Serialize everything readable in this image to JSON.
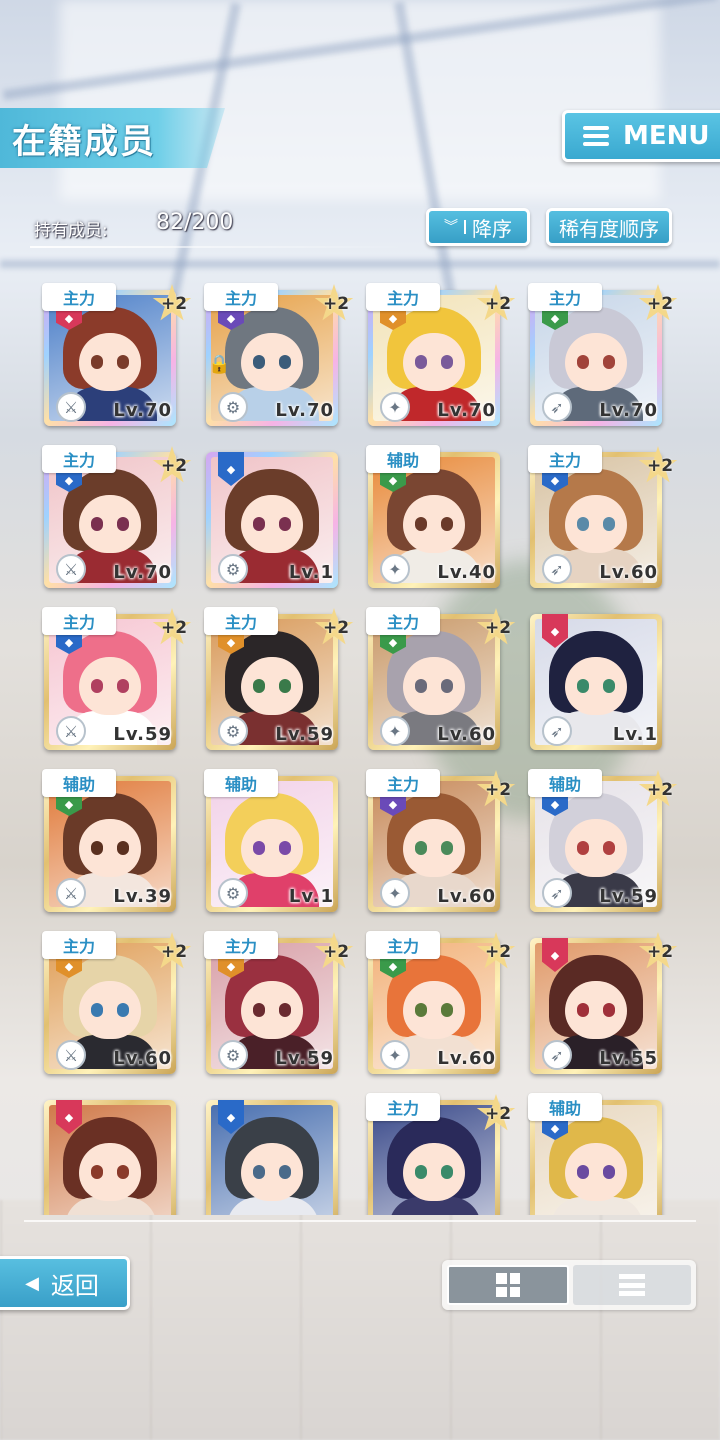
{
  "header": {
    "title": "在籍成员",
    "menu_label": "MENU"
  },
  "member_count": {
    "label": "持有成员:",
    "value": "82/200"
  },
  "sort": {
    "order_label": "降序",
    "order_icon": "chevron-double-down-icon",
    "rarity_label": "稀有度顺序"
  },
  "cards": [
    {
      "role": "主力",
      "attr": "red",
      "plus": "+2",
      "level": "Lv.70",
      "frame": "rainbow",
      "hair": "#8b3b2a",
      "eyes": "#7a3b2a",
      "outfit": "#2c3f7a",
      "bg": "#4c7fc8"
    },
    {
      "role": "主力",
      "attr": "purple",
      "plus": "+2",
      "level": "Lv.70",
      "frame": "rainbow",
      "hair": "#6f7780",
      "eyes": "#3b5c7a",
      "outfit": "#b8d0e8",
      "bg": "#e6a24a",
      "locked": true
    },
    {
      "role": "主力",
      "attr": "orange",
      "plus": "+2",
      "level": "Lv.70",
      "frame": "rainbow",
      "hair": "#f1c53c",
      "eyes": "#7a5a9a",
      "outfit": "#c0282b",
      "bg": "#f2e3b8"
    },
    {
      "role": "主力",
      "attr": "green",
      "plus": "+2",
      "level": "Lv.70",
      "frame": "rainbow",
      "hair": "#c9c9d6",
      "eyes": "#a1433a",
      "outfit": "#5e6a7a",
      "bg": "#c7d6e8"
    },
    {
      "role": "主力",
      "attr": "blue",
      "plus": "+2",
      "level": "Lv.70",
      "frame": "rainbow",
      "hair": "#6b3d2a",
      "eyes": "#7a3050",
      "outfit": "#9a2b32",
      "bg": "#f0c4c8"
    },
    {
      "role": "",
      "attr": "blue",
      "plus": "",
      "level": "Lv.1",
      "frame": "rainbow",
      "hair": "#6b3d2a",
      "eyes": "#7a3050",
      "outfit": "#9a2b32",
      "bg": "#f0c4c8"
    },
    {
      "role": "辅助",
      "attr": "green",
      "plus": "",
      "level": "Lv.40",
      "frame": "gold",
      "hair": "#7a4632",
      "eyes": "#6a3a2a",
      "outfit": "#f0ece6",
      "bg": "#e88a3a"
    },
    {
      "role": "主力",
      "attr": "blue",
      "plus": "+2",
      "level": "Lv.60",
      "frame": "gold",
      "hair": "#b5794a",
      "eyes": "#5a8aa8",
      "outfit": "#e6d3c2",
      "bg": "#d8c3a3"
    },
    {
      "role": "主力",
      "attr": "blue",
      "plus": "+2",
      "level": "Lv.59",
      "frame": "gold",
      "hair": "#ee6f8a",
      "eyes": "#b04060",
      "outfit": "#ffffff",
      "bg": "#f6c6d2"
    },
    {
      "role": "主力",
      "attr": "orange",
      "plus": "+2",
      "level": "Lv.59",
      "frame": "gold",
      "hair": "#2b2628",
      "eyes": "#3a7a4a",
      "outfit": "#7a3030",
      "bg": "#d89a5a"
    },
    {
      "role": "主力",
      "attr": "green",
      "plus": "+2",
      "level": "Lv.60",
      "frame": "gold",
      "hair": "#a8a2ad",
      "eyes": "#6a6a7a",
      "outfit": "#7a7a80",
      "bg": "#c99a6a"
    },
    {
      "role": "",
      "attr": "red",
      "plus": "",
      "level": "Lv.1",
      "frame": "gold",
      "hair": "#1f2240",
      "eyes": "#3a8a6a",
      "outfit": "#e8e8ec",
      "bg": "#d6dae8"
    },
    {
      "role": "辅助",
      "attr": "green",
      "plus": "",
      "level": "Lv.39",
      "frame": "gold",
      "hair": "#6a3a28",
      "eyes": "#5a3020",
      "outfit": "#f3e6de",
      "bg": "#e07a3a"
    },
    {
      "role": "辅助",
      "attr": "",
      "plus": "",
      "level": "Lv.1",
      "frame": "gold",
      "hair": "#f3cf5a",
      "eyes": "#7a4aa8",
      "outfit": "#e0406a",
      "bg": "#f2d2e8"
    },
    {
      "role": "主力",
      "attr": "purple",
      "plus": "+2",
      "level": "Lv.60",
      "frame": "gold",
      "hair": "#9a5a34",
      "eyes": "#4a8a5a",
      "outfit": "#e8d8cc",
      "bg": "#c78a5a"
    },
    {
      "role": "辅助",
      "attr": "blue",
      "plus": "+2",
      "level": "Lv.59",
      "frame": "gold",
      "hair": "#d2d0da",
      "eyes": "#b04040",
      "outfit": "#3a3a48",
      "bg": "#e6e2e8"
    },
    {
      "role": "主力",
      "attr": "orange",
      "plus": "+2",
      "level": "Lv.60",
      "frame": "gold",
      "hair": "#e6d4a8",
      "eyes": "#3a7ab0",
      "outfit": "#2a2a30",
      "bg": "#e0a05a"
    },
    {
      "role": "主力",
      "attr": "orange",
      "plus": "+2",
      "level": "Lv.59",
      "frame": "gold",
      "hair": "#9a3040",
      "eyes": "#6a2a30",
      "outfit": "#4a2028",
      "bg": "#d8a0a8"
    },
    {
      "role": "主力",
      "attr": "green",
      "plus": "+2",
      "level": "Lv.60",
      "frame": "gold",
      "hair": "#e8743a",
      "eyes": "#5a7a3a",
      "outfit": "#f2e0d2",
      "bg": "#f2b27a"
    },
    {
      "role": "",
      "attr": "red",
      "plus": "+2",
      "level": "Lv.55",
      "frame": "gold",
      "hair": "#5a2a24",
      "eyes": "#a0303a",
      "outfit": "#2a2028",
      "bg": "#e09a6a"
    },
    {
      "role": "",
      "attr": "red",
      "plus": "",
      "level": "",
      "frame": "gold",
      "hair": "#6a3024",
      "eyes": "#8a3a2a",
      "outfit": "#f0e0d4",
      "bg": "#d07a4a"
    },
    {
      "role": "",
      "attr": "blue",
      "plus": "",
      "level": "",
      "frame": "gold",
      "hair": "#3a4048",
      "eyes": "#4a6a8a",
      "outfit": "#e8eaf0",
      "bg": "#4a70b0"
    },
    {
      "role": "主力",
      "attr": "",
      "plus": "+2",
      "level": "",
      "frame": "gold",
      "hair": "#2a2a5a",
      "eyes": "#3a8a6a",
      "outfit": "#3a3a6a",
      "bg": "#3a4a8a"
    },
    {
      "role": "辅助",
      "attr": "blue",
      "plus": "",
      "level": "",
      "frame": "gold",
      "hair": "#e0b84a",
      "eyes": "#6a4aa0",
      "outfit": "#f0e8e0",
      "bg": "#e8d8c0"
    }
  ],
  "attr_colors": {
    "red": "#d8385a",
    "purple": "#6a4ab8",
    "orange": "#e0902a",
    "green": "#3a9a4a",
    "blue": "#2a6ac8"
  },
  "weapon_icon": "weapon-icon",
  "footer": {
    "back_label": "返回",
    "view_grid_icon": "grid-view-icon",
    "view_list_icon": "list-view-icon"
  }
}
